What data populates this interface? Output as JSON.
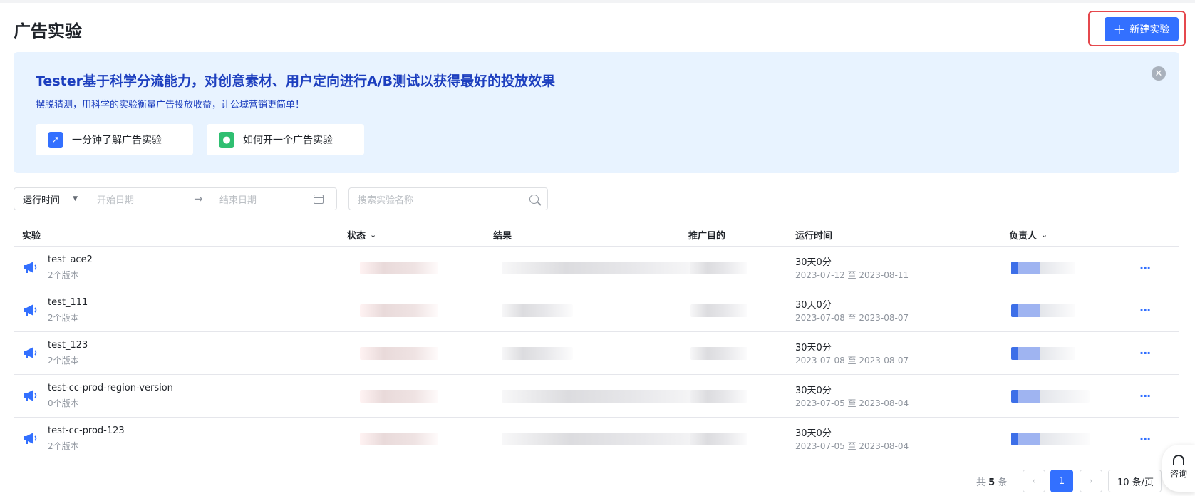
{
  "page": {
    "title": "广告实验"
  },
  "header": {
    "new_button_label": "新建实验"
  },
  "banner": {
    "title": "Tester基于科学分流能力，对创意素材、用户定向进行A/B测试以获得最好的投放效果",
    "subtitle": "摆脱猜测，用科学的实验衡量广告投放收益，让公域营销更简单！",
    "cards": [
      {
        "label": "一分钟了解广告实验"
      },
      {
        "label": "如何开一个广告实验"
      }
    ]
  },
  "filters": {
    "time_select": "运行时间",
    "start_placeholder": "开始日期",
    "end_placeholder": "结束日期",
    "search_placeholder": "搜索实验名称"
  },
  "table": {
    "columns": {
      "experiment": "实验",
      "status": "状态",
      "result": "结果",
      "purpose": "推广目的",
      "run_time": "运行时间",
      "owner": "负责人"
    },
    "rows": [
      {
        "name": "test_ace2",
        "versions": "2个版本",
        "run": "30天0分",
        "range": "2023-07-12 至 2023-08-11"
      },
      {
        "name": "test_111",
        "versions": "2个版本",
        "run": "30天0分",
        "range": "2023-07-08 至 2023-08-07"
      },
      {
        "name": "test_123",
        "versions": "2个版本",
        "run": "30天0分",
        "range": "2023-07-08 至 2023-08-07"
      },
      {
        "name": "test-cc-prod-region-version",
        "versions": "0个版本",
        "run": "30天0分",
        "range": "2023-07-05 至 2023-08-04"
      },
      {
        "name": "test-cc-prod-123",
        "versions": "2个版本",
        "run": "30天0分",
        "range": "2023-07-05 至 2023-08-04"
      }
    ]
  },
  "pagination": {
    "total_prefix": "共",
    "total_count": "5",
    "total_suffix": "条",
    "current_page": "1",
    "page_size": "10 条/页"
  },
  "consult": {
    "label": "咨询"
  },
  "colors": {
    "primary": "#3370ff",
    "banner_bg": "#e8f3ff",
    "banner_text": "#1d3fbf",
    "highlight_frame": "#e5484d"
  }
}
